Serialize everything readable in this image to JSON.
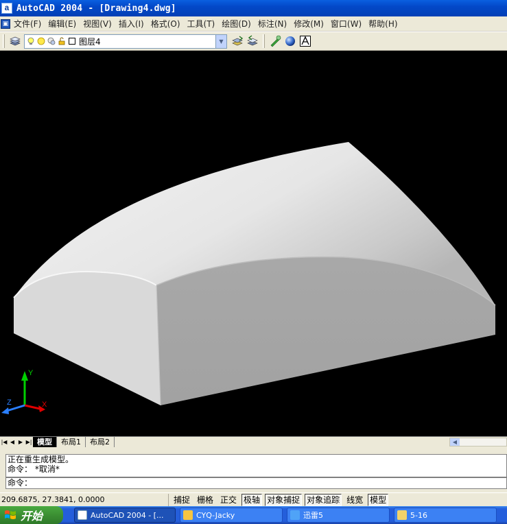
{
  "window": {
    "title": "AutoCAD 2004 - [Drawing4.dwg]",
    "app_icon": "a"
  },
  "menubar": {
    "items": [
      "文件(F)",
      "编辑(E)",
      "视图(V)",
      "插入(I)",
      "格式(O)",
      "工具(T)",
      "绘图(D)",
      "标注(N)",
      "修改(M)",
      "窗口(W)",
      "帮助(H)"
    ]
  },
  "toolbar": {
    "layer_name": "图层4"
  },
  "layout_tabs": [
    "模型",
    "布局1",
    "布局2"
  ],
  "ucs": {
    "y_label": "Y",
    "z_label": "Z",
    "x_label": "X"
  },
  "command": {
    "history": [
      "正在重生成模型。",
      "命令： *取消*"
    ],
    "prompt": "命令："
  },
  "status": {
    "coords": "209.6875, 27.3841, 0.0000",
    "buttons": [
      {
        "label": "捕捉",
        "on": false
      },
      {
        "label": "栅格",
        "on": false
      },
      {
        "label": "正交",
        "on": false
      },
      {
        "label": "极轴",
        "on": true
      },
      {
        "label": "对象捕捉",
        "on": true
      },
      {
        "label": "对象追踪",
        "on": true
      },
      {
        "label": "线宽",
        "on": false
      },
      {
        "label": "模型",
        "on": true
      }
    ]
  },
  "taskbar": {
    "start_label": "开始",
    "tasks": [
      "AutoCAD 2004 - [...",
      "CYQ-Jacky",
      "迅雷5",
      "5-16"
    ]
  },
  "colors": {
    "accent": "#0a5fe0",
    "viewport_bg": "#000000"
  }
}
